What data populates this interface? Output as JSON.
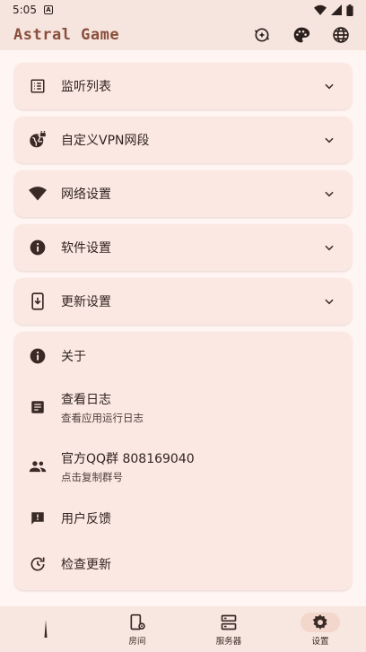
{
  "status": {
    "time": "5:05",
    "badge": "A"
  },
  "app": {
    "title": "Astral Game"
  },
  "settings_sections": [
    {
      "label": "监听列表",
      "icon": "list-icon"
    },
    {
      "label": "自定义VPN网段",
      "icon": "vpn-lock-icon"
    },
    {
      "label": "网络设置",
      "icon": "wifi-icon"
    },
    {
      "label": "软件设置",
      "icon": "info-icon"
    },
    {
      "label": "更新设置",
      "icon": "phone-download-icon"
    }
  ],
  "about": {
    "items": [
      {
        "title": "关于",
        "subtitle": "",
        "icon": "info-icon"
      },
      {
        "title": "查看日志",
        "subtitle": "查看应用运行日志",
        "icon": "document-icon"
      },
      {
        "title": "官方QQ群 808169040",
        "subtitle": "点击复制群号",
        "icon": "group-icon"
      },
      {
        "title": "用户反馈",
        "subtitle": "",
        "icon": "feedback-icon"
      },
      {
        "title": "检查更新",
        "subtitle": "",
        "icon": "update-icon"
      }
    ]
  },
  "nav": [
    {
      "label": "",
      "icon": "home-icon"
    },
    {
      "label": "房间",
      "icon": "room-icon"
    },
    {
      "label": "服务器",
      "icon": "server-icon"
    },
    {
      "label": "设置",
      "icon": "settings-icon",
      "active": true
    }
  ],
  "colors": {
    "accent": "#8a4f3c",
    "card": "#fce8e3",
    "background": "#fff5f2",
    "bar": "#f6e4de"
  }
}
